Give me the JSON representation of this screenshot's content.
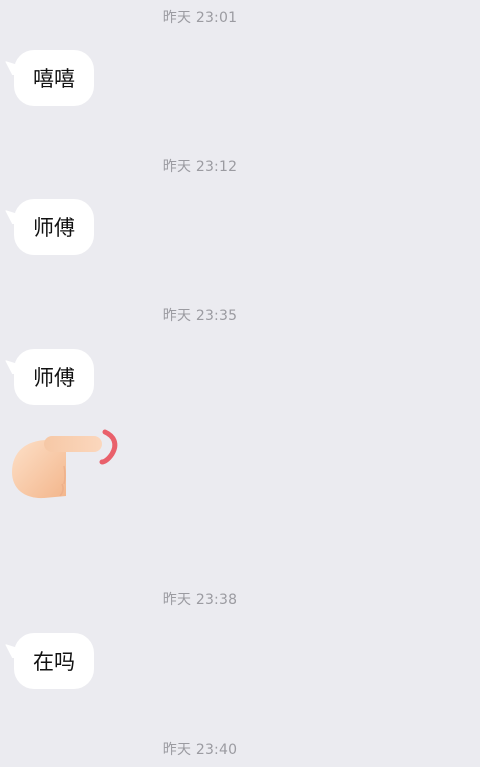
{
  "messages": [
    {
      "timestamp": "昨天 23:01",
      "text": "嘻嘻"
    },
    {
      "timestamp": "昨天 23:12",
      "text": "师傅"
    },
    {
      "timestamp": "昨天 23:35",
      "text": "师傅"
    },
    {
      "timestamp": "昨天 23:38",
      "text": "在吗"
    },
    {
      "timestamp": "昨天 23:40"
    }
  ],
  "sticker": {
    "icon": "pointing-hand-icon"
  },
  "colors": {
    "background": "#ebebf0",
    "bubble": "#ffffff",
    "timestamp_text": "#9b9ba1",
    "message_text": "#111111",
    "skin": "#f7c7a2",
    "accent": "#e9606b"
  }
}
